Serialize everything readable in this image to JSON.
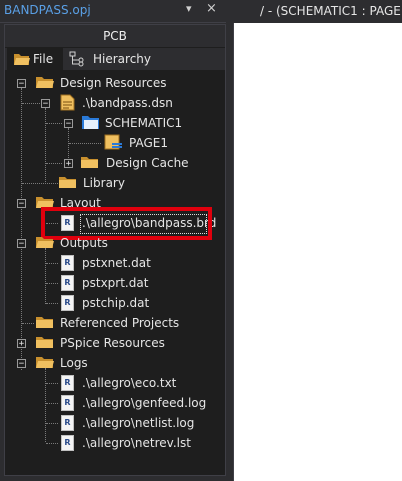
{
  "window": {
    "panel_title": "BANDPASS.opj",
    "pin": "▾",
    "close": "×",
    "doc_tab": "/ - (SCHEMATIC1 : PAGE1)"
  },
  "panel": {
    "heading": "PCB",
    "tabs": [
      {
        "label": "File",
        "active": true
      },
      {
        "label": "Hierarchy",
        "active": false
      }
    ]
  },
  "tree": {
    "design_resources": "Design Resources",
    "dsn": ".\\bandpass.dsn",
    "schematic": "SCHEMATIC1",
    "page": "PAGE1",
    "design_cache": "Design Cache",
    "library": "Library",
    "layout": "Layout",
    "brd": ".\\allegro\\bandpass.brd",
    "outputs": "Outputs",
    "out1": "pstxnet.dat",
    "out2": "pstxprt.dat",
    "out3": "pstchip.dat",
    "referenced": "Referenced Projects",
    "pspice": "PSpice Resources",
    "logs": "Logs",
    "log1": ".\\allegro\\eco.txt",
    "log2": ".\\allegro\\genfeed.log",
    "log3": ".\\allegro\\netlist.log",
    "log4": ".\\allegro\\netrev.lst"
  },
  "colors": {
    "accent": "#5aa0e6",
    "highlight": "#e0000d",
    "folder": "#e8b04a"
  }
}
